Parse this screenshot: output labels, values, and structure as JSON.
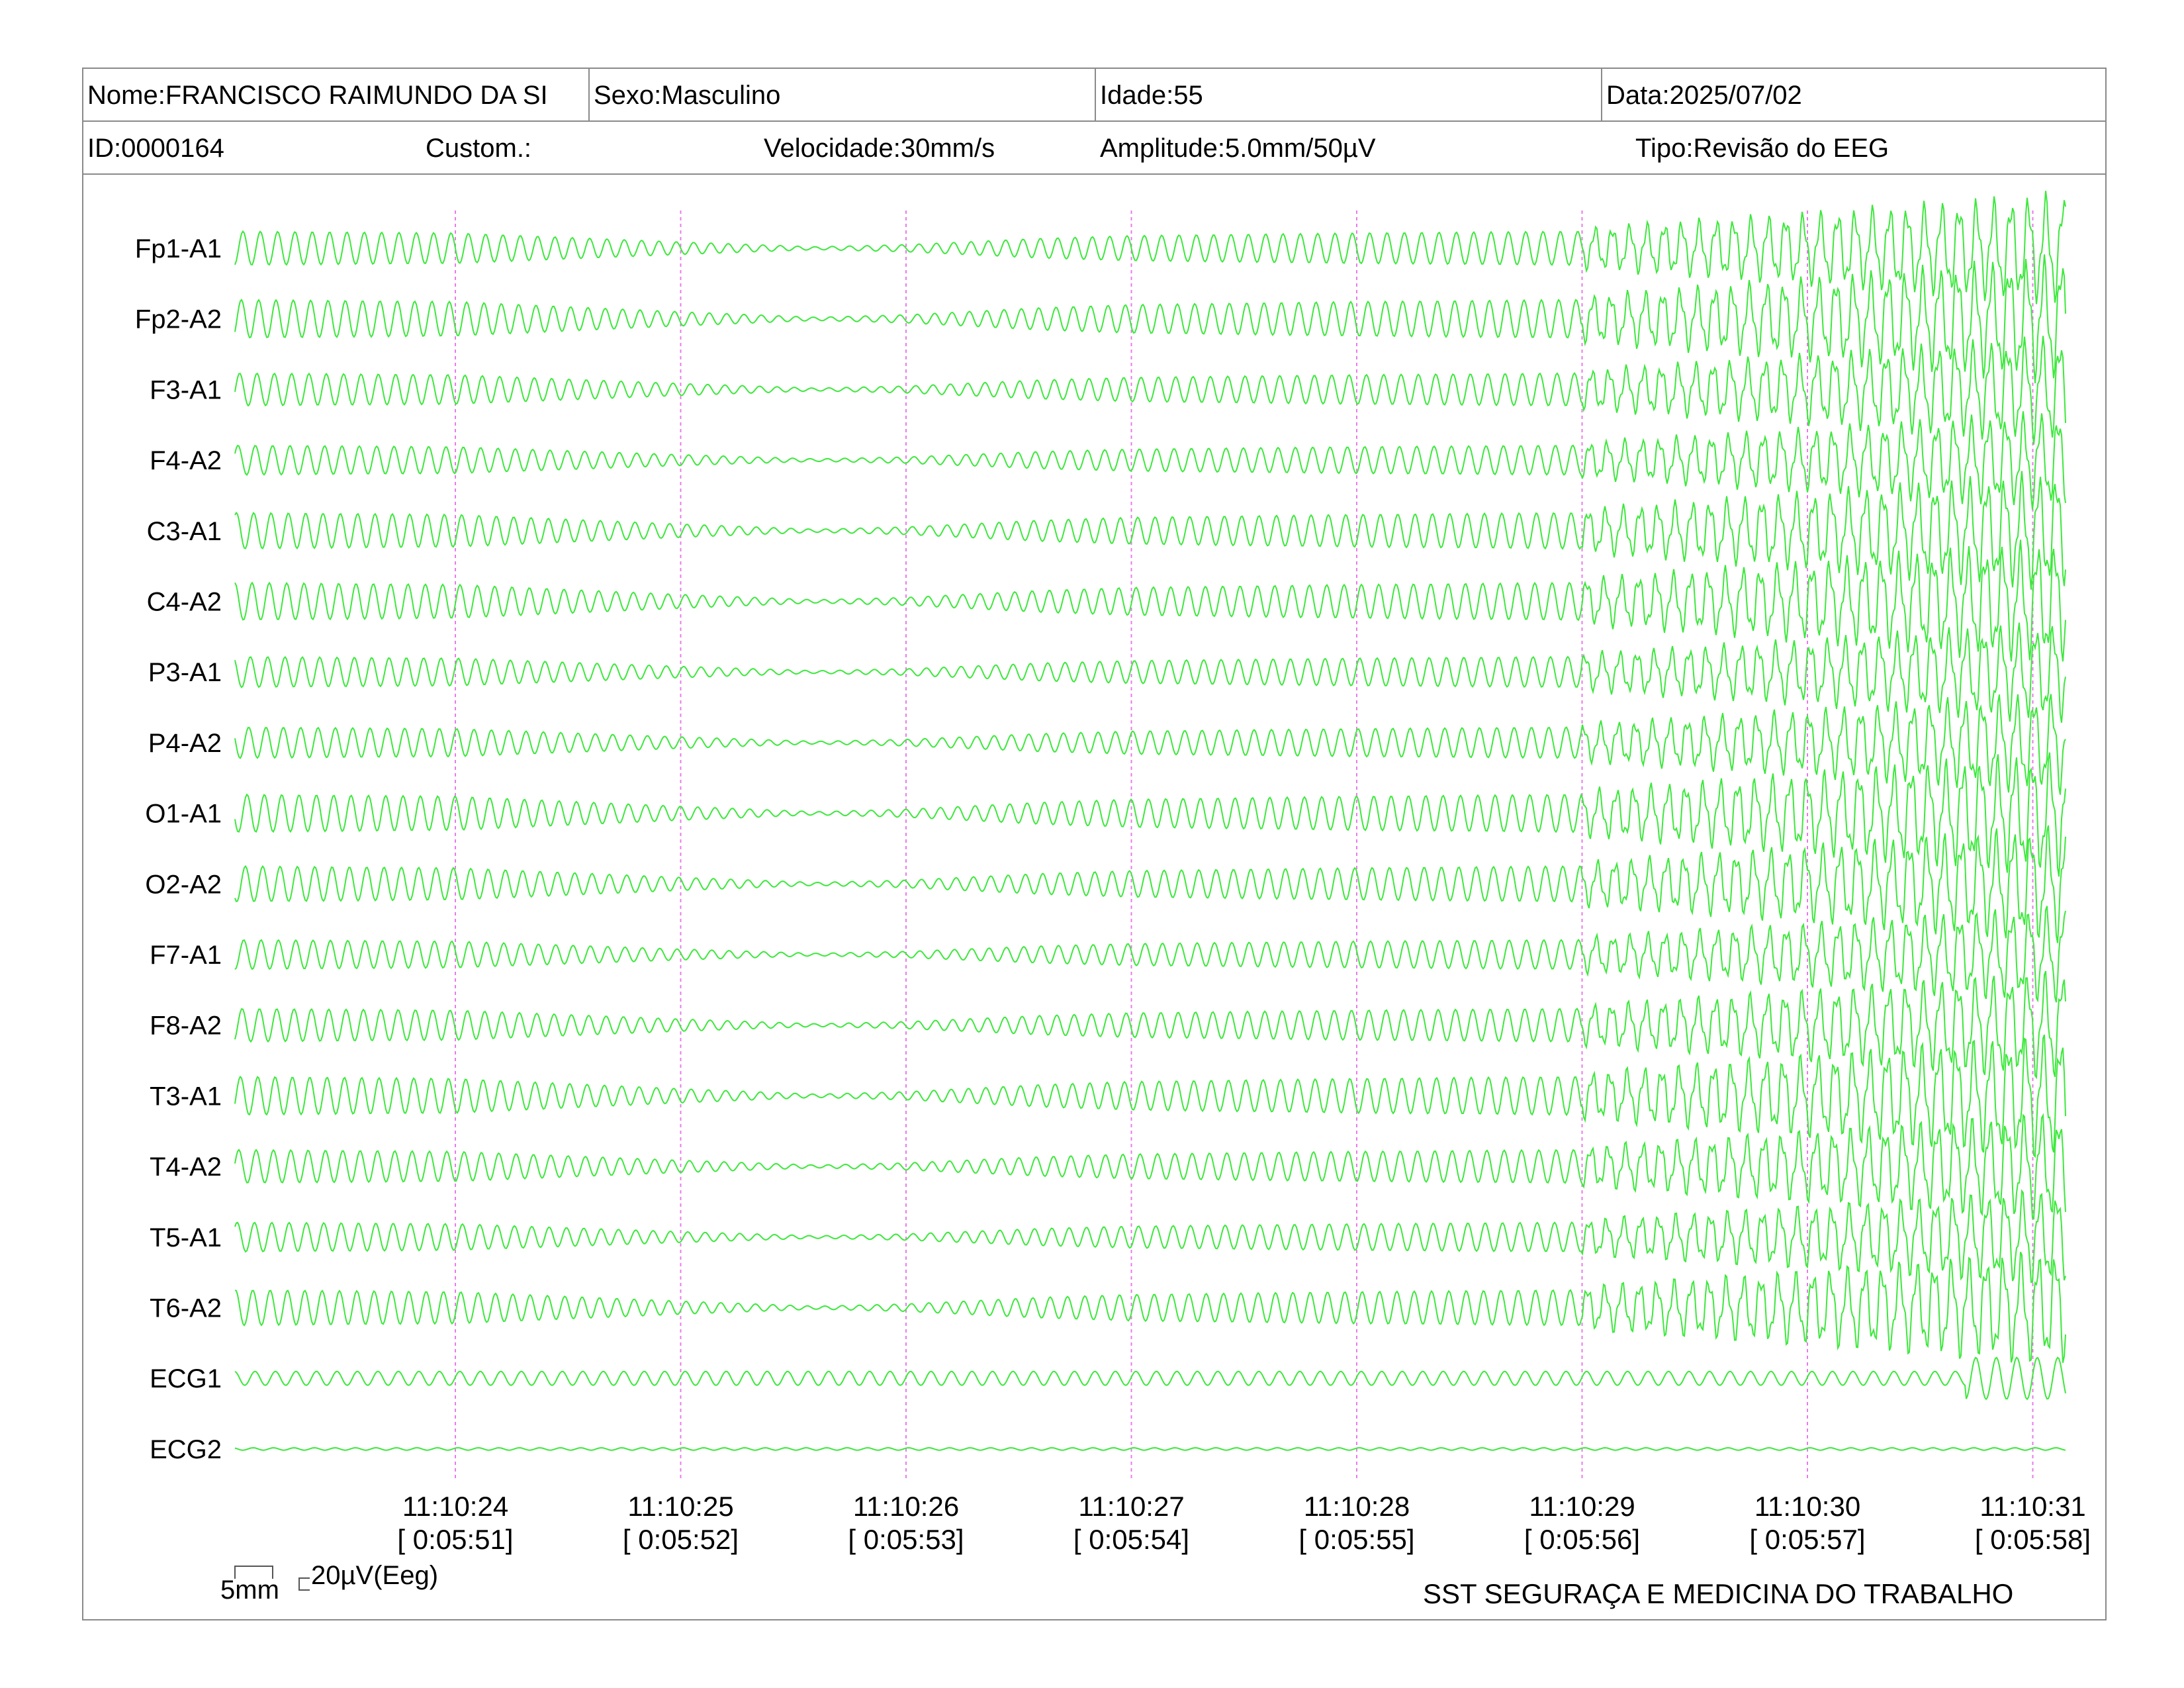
{
  "header": {
    "name": "Nome:FRANCISCO RAIMUNDO DA SI",
    "sex": "Sexo:Masculino",
    "age": "Idade:55",
    "date": "Data:2025/07/02",
    "id": "ID:0000164",
    "custom": "Custom.:",
    "speed": "Velocidade:30mm/s",
    "amplitude": "Amplitude:5.0mm/50µV",
    "type": "Tipo:Revisão do EEG"
  },
  "scale": {
    "mm_label": "5mm",
    "uv_label": "20µV(Eeg)"
  },
  "footer": {
    "clinic": "SST SEGURAÇA E MEDICINA DO TRABALHO"
  },
  "colors": {
    "trace": "#3ce83c",
    "second_marker": "#e87be8",
    "border": "#8a8a8a"
  },
  "chart_data": {
    "type": "line",
    "title": "",
    "channels": [
      "Fp1-A1",
      "Fp2-A2",
      "F3-A1",
      "F4-A2",
      "C3-A1",
      "C4-A2",
      "P3-A1",
      "P4-A2",
      "O1-A1",
      "O2-A2",
      "F7-A1",
      "F8-A2",
      "T3-A1",
      "T4-A2",
      "T5-A1",
      "T6-A2",
      "ECG1",
      "ECG2"
    ],
    "time_ticks": [
      "11:10:24",
      "11:10:25",
      "11:10:26",
      "11:10:27",
      "11:10:28",
      "11:10:29",
      "11:10:30",
      "11:10:31"
    ],
    "elapsed_ticks": [
      "[ 0:05:51]",
      "[ 0:05:52]",
      "[ 0:05:53]",
      "[ 0:05:54]",
      "[ 0:05:55]",
      "[ 0:05:56]",
      "[ 0:05:57]",
      "[ 0:05:58]"
    ],
    "x_range_seconds": [
      -1.0,
      7.05
    ],
    "frequency_hz": 13,
    "ecg_frequency_hz": 11,
    "amplitude_envelope": {
      "t_seconds": [
        -1.0,
        0.0,
        0.6,
        1.0,
        1.6,
        2.0,
        2.6,
        3.0,
        4.0,
        5.0,
        6.0,
        7.05
      ],
      "relative": [
        0.95,
        0.85,
        0.55,
        0.35,
        0.08,
        0.2,
        0.55,
        0.7,
        0.85,
        0.95,
        1.6,
        2.4
      ]
    },
    "grid": "vertical dotted lines every 1 second"
  }
}
